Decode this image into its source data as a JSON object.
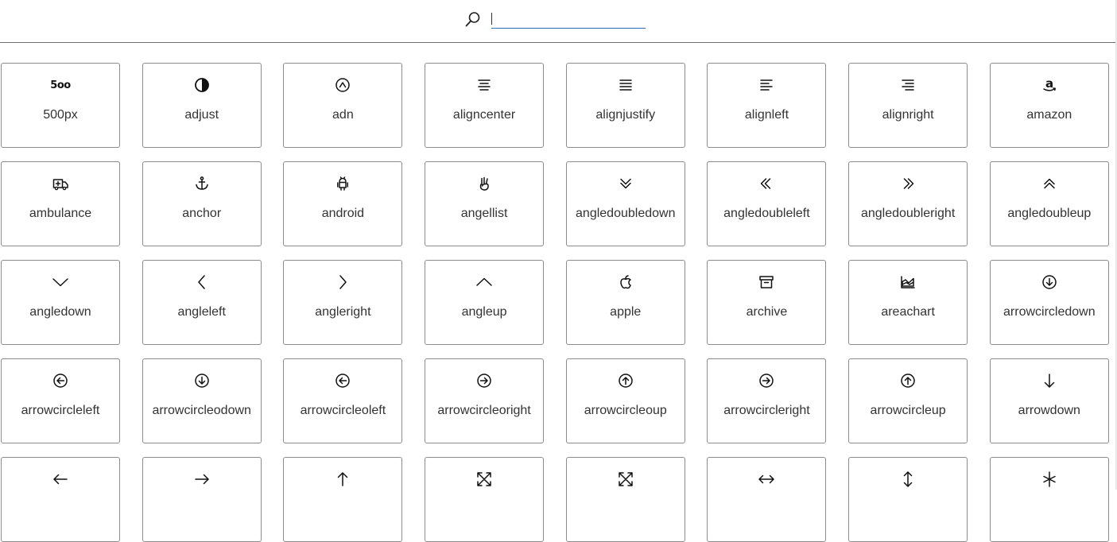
{
  "search": {
    "value": "",
    "placeholder": ""
  },
  "icons": [
    {
      "label": "500px",
      "icon": "fivehundredpx-icon"
    },
    {
      "label": "adjust",
      "icon": "adjust-icon"
    },
    {
      "label": "adn",
      "icon": "adn-icon"
    },
    {
      "label": "aligncenter",
      "icon": "align-center-icon"
    },
    {
      "label": "alignjustify",
      "icon": "align-justify-icon"
    },
    {
      "label": "alignleft",
      "icon": "align-left-icon"
    },
    {
      "label": "alignright",
      "icon": "align-right-icon"
    },
    {
      "label": "amazon",
      "icon": "amazon-icon"
    },
    {
      "label": "ambulance",
      "icon": "ambulance-icon"
    },
    {
      "label": "anchor",
      "icon": "anchor-icon"
    },
    {
      "label": "android",
      "icon": "android-icon"
    },
    {
      "label": "angellist",
      "icon": "angellist-icon"
    },
    {
      "label": "angledoubledown",
      "icon": "angle-double-down-icon"
    },
    {
      "label": "angledoubleleft",
      "icon": "angle-double-left-icon"
    },
    {
      "label": "angledoubleright",
      "icon": "angle-double-right-icon"
    },
    {
      "label": "angledoubleup",
      "icon": "angle-double-up-icon"
    },
    {
      "label": "angledown",
      "icon": "angle-down-icon"
    },
    {
      "label": "angleleft",
      "icon": "angle-left-icon"
    },
    {
      "label": "angleright",
      "icon": "angle-right-icon"
    },
    {
      "label": "angleup",
      "icon": "angle-up-icon"
    },
    {
      "label": "apple",
      "icon": "apple-icon"
    },
    {
      "label": "archive",
      "icon": "archive-icon"
    },
    {
      "label": "areachart",
      "icon": "area-chart-icon"
    },
    {
      "label": "arrowcircledown",
      "icon": "arrow-circle-down-icon"
    },
    {
      "label": "arrowcircleleft",
      "icon": "arrow-circle-left-icon"
    },
    {
      "label": "arrowcircleodown",
      "icon": "arrow-circle-o-down-icon"
    },
    {
      "label": "arrowcircleoleft",
      "icon": "arrow-circle-o-left-icon"
    },
    {
      "label": "arrowcircleoright",
      "icon": "arrow-circle-o-right-icon"
    },
    {
      "label": "arrowcircleoup",
      "icon": "arrow-circle-o-up-icon"
    },
    {
      "label": "arrowcircleright",
      "icon": "arrow-circle-right-icon"
    },
    {
      "label": "arrowcircleup",
      "icon": "arrow-circle-up-icon"
    },
    {
      "label": "arrowdown",
      "icon": "arrow-down-icon"
    },
    {
      "label": "",
      "icon": "arrow-left-icon"
    },
    {
      "label": "",
      "icon": "arrow-right-icon"
    },
    {
      "label": "",
      "icon": "arrow-up-icon"
    },
    {
      "label": "",
      "icon": "expand-arrows-icon"
    },
    {
      "label": "",
      "icon": "expand-arrows-alt-icon"
    },
    {
      "label": "",
      "icon": "arrows-horizontal-icon"
    },
    {
      "label": "",
      "icon": "arrows-vertical-icon"
    },
    {
      "label": "",
      "icon": "asterisk-icon"
    }
  ]
}
